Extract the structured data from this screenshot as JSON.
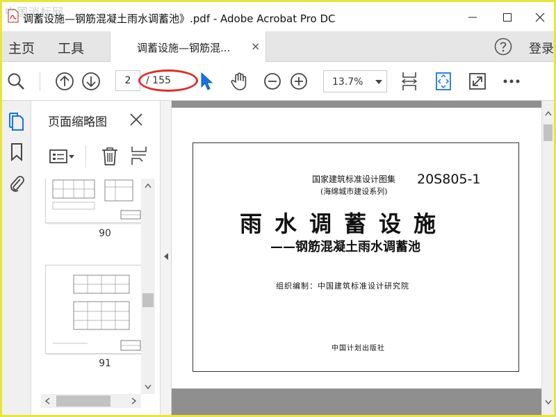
{
  "window": {
    "title": "调蓄设施—钢筋混凝土雨水调蓄池》.pdf - Adobe Acrobat Pro DC",
    "watermark": "中国消标网"
  },
  "tabs": {
    "home": "主页",
    "tools": "工具",
    "document_tab": "调蓄设施—钢筋混...",
    "close_glyph": "×",
    "signin": "登录"
  },
  "toolbar": {
    "current_page": "2",
    "total_pages": "/ 155",
    "zoom": "13.7%"
  },
  "thumbnails": {
    "panel_title": "页面缩略图",
    "pages": [
      {
        "label": "90"
      },
      {
        "label": "91"
      }
    ]
  },
  "document": {
    "collection": "国家建筑标准设计图集",
    "series": "(海绵城市建设系列)",
    "code": "20S805-1",
    "title": "雨水调蓄设施",
    "subtitle": "——钢筋混凝土雨水调蓄池",
    "compiler": "组织编制：中国建筑标准设计研究院",
    "publisher": "中国计划出版社"
  },
  "colors": {
    "accent_blue": "#1473e6",
    "annotation_red": "#e02b2b",
    "frame_yellow": "#e8e43a"
  }
}
